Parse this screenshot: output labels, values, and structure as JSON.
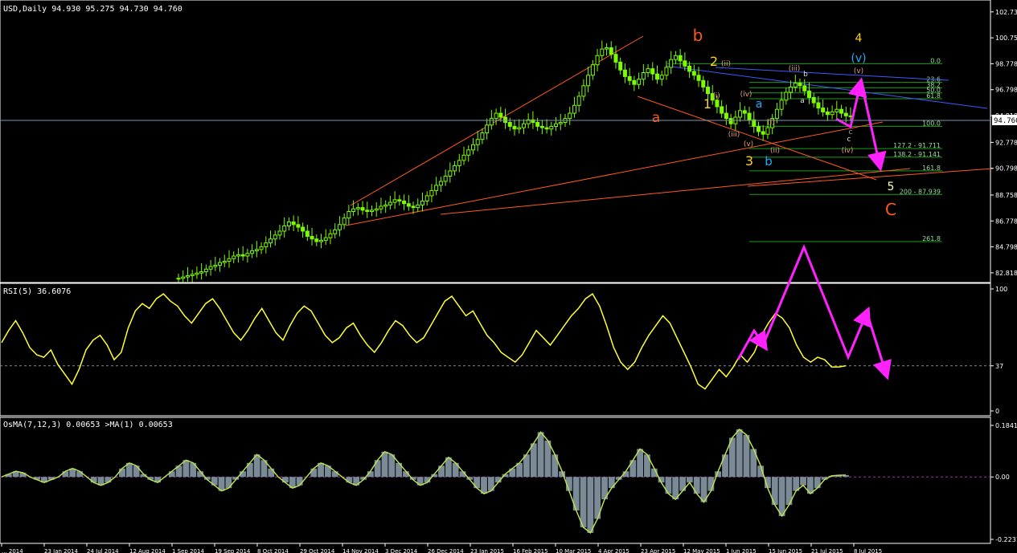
{
  "window": {
    "symbol_header": "USD,Daily  94.930 95.275 94.730 94.760",
    "rsi_header": "RSI(5) 36.6076",
    "osma_header": "OsMA(7,12,3) 0.00653  >MA(1) 0.00653"
  },
  "colors": {
    "background": "#000000",
    "grid_panel_border": "#ffffff",
    "candles": "#7cfc00",
    "rsi_line": "#ffff33",
    "osma_line": "#b8e050",
    "osma_hist": "#7a8a96",
    "trend_orange": "#ff5a1e",
    "trend_blue": "#3b5bff",
    "projection_magenta": "#ff22ff",
    "fib_lines": "#1e9a1e"
  },
  "chart_data": [
    {
      "type": "candlestick",
      "title": "USD,Daily",
      "ohlc_last": {
        "open": 94.93,
        "high": 95.275,
        "low": 94.73,
        "close": 94.76
      },
      "current_price_label": "94.760",
      "y_ticks": [
        "102.738",
        "100.758",
        "98.778",
        "96.798",
        "94.818",
        "92.778",
        "90.798",
        "88.758",
        "86.778",
        "84.798",
        "82.818"
      ],
      "ylim": [
        82.2,
        103.4
      ],
      "x_ticks": [
        "... 2014",
        "23 Jan 2014",
        "24 Jul 2014",
        "12 Aug 2014",
        "1 Sep 2014",
        "19 Sep 2014",
        "8 Oct 2014",
        "29 Oct 2014",
        "14 Nov 2014",
        "3 Dec 2014",
        "26 Dec 2014",
        "23 Jan 2015",
        "16 Feb 2015",
        "10 Mar 2015",
        "4 Apr 2015",
        "23 Apr 2015",
        "12 May 2015",
        "1 Jun 2015",
        "15 Jun 2015",
        "21 Jul 2015",
        "8 Jul 2015"
      ],
      "close_series": [
        82.4,
        82.5,
        82.6,
        82.7,
        82.8,
        82.9,
        83.1,
        83.3,
        83.4,
        83.6,
        83.7,
        83.9,
        84.1,
        84.2,
        84.1,
        84.3,
        84.5,
        84.6,
        84.8,
        85.1,
        85.4,
        85.7,
        86.0,
        86.4,
        86.7,
        86.5,
        86.3,
        86.0,
        85.6,
        85.4,
        85.2,
        85.3,
        85.5,
        85.8,
        86.1,
        86.5,
        87.0,
        87.5,
        87.7,
        87.8,
        87.6,
        87.5,
        87.6,
        87.7,
        87.9,
        88.0,
        88.2,
        88.4,
        88.3,
        88.1,
        87.9,
        87.8,
        88.0,
        88.3,
        88.7,
        89.1,
        89.5,
        89.8,
        90.2,
        90.6,
        91.0,
        91.4,
        91.8,
        92.2,
        92.6,
        93.0,
        93.5,
        94.1,
        94.6,
        95.0,
        94.7,
        94.3,
        94.0,
        93.8,
        93.9,
        94.2,
        94.5,
        94.3,
        94.0,
        93.9,
        93.8,
        94.0,
        94.2,
        94.3,
        94.6,
        95.0,
        95.6,
        96.3,
        97.1,
        97.9,
        98.7,
        99.4,
        99.9,
        100.0,
        99.5,
        98.9,
        98.3,
        97.8,
        97.5,
        97.2,
        97.6,
        98.1,
        98.4,
        98.0,
        97.6,
        97.9,
        98.5,
        99.1,
        99.4,
        99.0,
        98.6,
        98.2,
        97.9,
        97.5,
        97.0,
        96.5,
        96.0,
        95.5,
        95.0,
        94.6,
        94.2,
        94.7,
        95.2,
        95.0,
        94.5,
        94.0,
        93.6,
        93.4,
        93.9,
        94.6,
        95.3,
        96.0,
        96.6,
        97.0,
        97.3,
        97.1,
        96.7,
        96.2,
        95.8,
        95.4,
        95.1,
        94.9,
        95.1,
        95.3,
        95.0,
        94.8,
        94.76
      ],
      "wave_labels": [
        "a",
        "b",
        "1",
        "2",
        "3",
        "b",
        "a",
        "c",
        "4",
        "5",
        "C",
        "(i)",
        "(ii)",
        "(iii)",
        "(iv)",
        "(v)",
        "(i)",
        "(ii)",
        "(iii)",
        "(iv)",
        "(v)",
        "(v)",
        "a",
        "b",
        "c"
      ],
      "fib_labels": [
        "0.0",
        "23.6",
        "38.2",
        "50.0",
        "61.8",
        "100.0",
        "127.2 - 91.711",
        "138.2 - 91.141",
        "161.8",
        "200 - 87.939",
        "261.8"
      ]
    },
    {
      "type": "line",
      "title": "RSI(5) 36.6076",
      "y_ticks": [
        "100",
        "37",
        "0"
      ],
      "ylim": [
        0,
        100
      ],
      "level": 37,
      "last_value": 36.6076,
      "values": [
        56,
        66,
        74,
        64,
        52,
        46,
        44,
        50,
        38,
        30,
        22,
        34,
        50,
        58,
        62,
        54,
        42,
        48,
        68,
        82,
        88,
        84,
        92,
        96,
        90,
        86,
        78,
        72,
        80,
        88,
        92,
        84,
        74,
        64,
        58,
        66,
        76,
        84,
        74,
        64,
        58,
        70,
        80,
        86,
        82,
        72,
        62,
        56,
        60,
        68,
        72,
        62,
        54,
        48,
        56,
        66,
        74,
        70,
        62,
        56,
        60,
        70,
        80,
        90,
        94,
        86,
        78,
        82,
        72,
        62,
        56,
        48,
        44,
        40,
        46,
        56,
        66,
        60,
        54,
        62,
        70,
        78,
        84,
        92,
        96,
        86,
        70,
        52,
        40,
        34,
        40,
        52,
        62,
        70,
        78,
        72,
        60,
        48,
        36,
        22,
        18,
        26,
        34,
        28,
        36,
        46,
        40,
        48,
        62,
        72,
        80,
        76,
        68,
        54,
        44,
        40,
        44,
        42,
        36,
        36,
        37
      ]
    },
    {
      "type": "bar",
      "title": "OsMA(7,12,3) 0.00653",
      "y_ticks": [
        "0.1841",
        "0.00",
        "-0.2231"
      ],
      "ylim": [
        -0.2231,
        0.1841
      ],
      "last_value": 0.00653,
      "values": [
        0.0,
        0.01,
        0.02,
        0.015,
        0.0,
        -0.01,
        -0.02,
        -0.01,
        0.0,
        0.02,
        0.03,
        0.02,
        0.0,
        -0.02,
        -0.03,
        -0.02,
        0.0,
        0.03,
        0.05,
        0.04,
        0.01,
        -0.01,
        -0.02,
        0.0,
        0.02,
        0.04,
        0.06,
        0.05,
        0.02,
        -0.01,
        -0.03,
        -0.05,
        -0.04,
        -0.01,
        0.02,
        0.05,
        0.08,
        0.06,
        0.03,
        0.0,
        -0.02,
        -0.04,
        -0.03,
        0.0,
        0.03,
        0.05,
        0.04,
        0.02,
        0.0,
        -0.02,
        -0.03,
        -0.01,
        0.02,
        0.06,
        0.09,
        0.08,
        0.05,
        0.02,
        -0.01,
        -0.03,
        -0.02,
        0.01,
        0.04,
        0.07,
        0.05,
        0.02,
        -0.01,
        -0.04,
        -0.06,
        -0.05,
        -0.02,
        0.01,
        0.03,
        0.05,
        0.08,
        0.12,
        0.16,
        0.13,
        0.08,
        0.02,
        -0.05,
        -0.12,
        -0.18,
        -0.2,
        -0.15,
        -0.08,
        -0.04,
        -0.01,
        0.02,
        0.06,
        0.1,
        0.08,
        0.03,
        -0.02,
        -0.06,
        -0.08,
        -0.05,
        -0.02,
        -0.06,
        -0.09,
        -0.05,
        0.02,
        0.08,
        0.14,
        0.17,
        0.15,
        0.1,
        0.04,
        -0.04,
        -0.1,
        -0.14,
        -0.1,
        -0.05,
        -0.03,
        -0.06,
        -0.04,
        -0.01,
        0.004,
        0.006,
        0.00653
      ]
    }
  ]
}
